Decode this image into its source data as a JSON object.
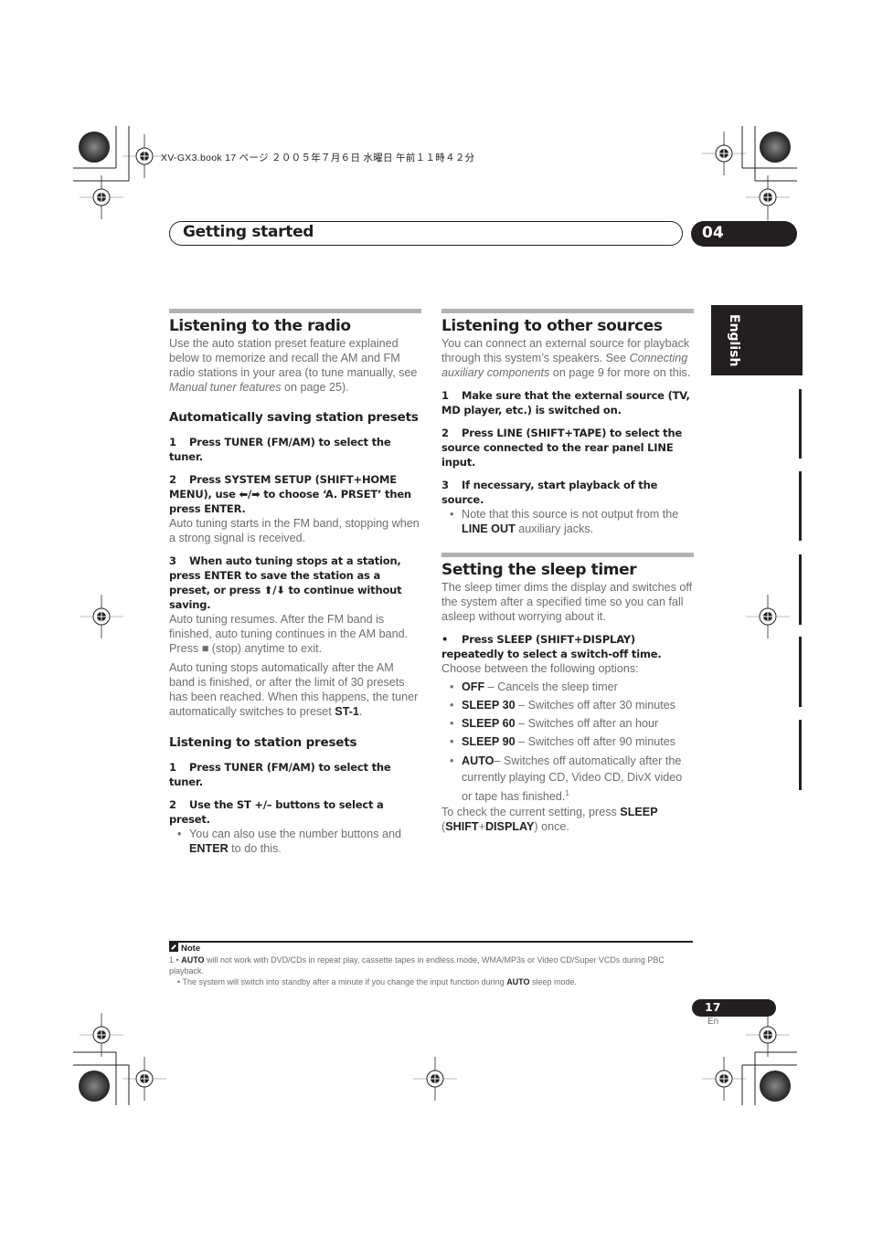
{
  "print_header": "XV-GX3.book  17 ページ  ２００５年７月６日  水曜日  午前１１時４２分",
  "chapter": {
    "title": "Getting started",
    "number": "04"
  },
  "language_tab": "English",
  "left_column": {
    "radio": {
      "heading": "Listening to the radio",
      "intro_pre": "Use the auto station preset feature explained below to memorize and recall the AM and FM radio stations in your area (to tune manually, see ",
      "intro_link": "Manual tuner features",
      "intro_post": " on page 25)."
    },
    "auto_presets": {
      "heading": "Automatically saving station presets",
      "step1_num": "1",
      "step1": "Press TUNER (FM/AM) to select the tuner.",
      "step2_num": "2",
      "step2": "Press SYSTEM SETUP (SHIFT+HOME MENU), use ⬅/➡ to choose ‘A. PRSET’ then press ENTER.",
      "step2_body": "Auto tuning starts in the FM band, stopping when a strong signal is received.",
      "step3_num": "3",
      "step3": "When auto tuning stops at a station, press ENTER to save the station as a preset, or press ⬆/⬇ to continue without saving.",
      "step3_body": "Auto tuning resumes. After the FM band is finished, auto tuning continues in the AM band. Press ■ (stop) anytime to exit.",
      "step3_body2_pre": "Auto tuning stops automatically after the AM band is finished, or after the limit of 30 presets has been reached. When this happens, the tuner automatically switches to preset ",
      "step3_body2_bold": "ST-1",
      "step3_body2_post": "."
    },
    "station_presets": {
      "heading": "Listening to station presets",
      "step1_num": "1",
      "step1": "Press TUNER (FM/AM) to select the tuner.",
      "step2_num": "2",
      "step2": "Use the ST +/– buttons to select a preset.",
      "bullet_pre": "You can also use the number buttons and ",
      "bullet_bold": "ENTER",
      "bullet_post": " to do this."
    }
  },
  "right_column": {
    "other_sources": {
      "heading": "Listening to other sources",
      "intro_pre": "You can connect an external source for playback through this system’s speakers. See ",
      "intro_link": "Connecting auxiliary components",
      "intro_post": " on page 9 for more on this.",
      "step1_num": "1",
      "step1": "Make sure that the external source (TV, MD player, etc.) is switched on.",
      "step2_num": "2",
      "step2": "Press LINE (SHIFT+TAPE) to select the source connected to the rear panel LINE input.",
      "step3_num": "3",
      "step3": "If necessary, start playback of the source.",
      "bullet_pre": "Note that this source is not output from the ",
      "bullet_bold": "LINE OUT",
      "bullet_post": " auxiliary jacks."
    },
    "sleep_timer": {
      "heading": "Setting the sleep timer",
      "intro": "The sleep timer dims the display and switches off the system after a specified time so you can fall asleep without worrying about it.",
      "step_bullet": "•",
      "step": "Press SLEEP (SHIFT+DISPLAY) repeatedly to select a switch-off time.",
      "step_body": "Choose between the following options:",
      "options": [
        {
          "name": "OFF",
          "desc": " – Cancels the sleep timer"
        },
        {
          "name": "SLEEP 30",
          "desc": " – Switches off after 30 minutes"
        },
        {
          "name": "SLEEP 60",
          "desc": " – Switches off after an hour"
        },
        {
          "name": "SLEEP 90",
          "desc": " – Switches off after 90 minutes"
        },
        {
          "name": "AUTO",
          "desc": "– Switches off automatically after the currently playing CD, Video CD, DivX video or tape has finished.",
          "footnote": "1"
        }
      ],
      "check_pre": "To check the current setting, press ",
      "check_bold1": "SLEEP",
      "check_mid1": " (",
      "check_bold2": "SHIFT",
      "check_plus": "+",
      "check_bold3": "DISPLAY",
      "check_post": ") once."
    }
  },
  "note": {
    "title": "Note",
    "line1_num": "1",
    "line1_bullet": "•",
    "line1_bold": "AUTO",
    "line1_text": " will not work with DVD/CDs in repeat play, cassette tapes in endless mode, WMA/MP3s or Video CD/Super VCDs during PBC playback.",
    "line2_pre": "The system will switch into standby after a minute if you change the input function during ",
    "line2_bold": "AUTO",
    "line2_post": " sleep mode."
  },
  "page": {
    "number": "17",
    "lang": "En"
  }
}
